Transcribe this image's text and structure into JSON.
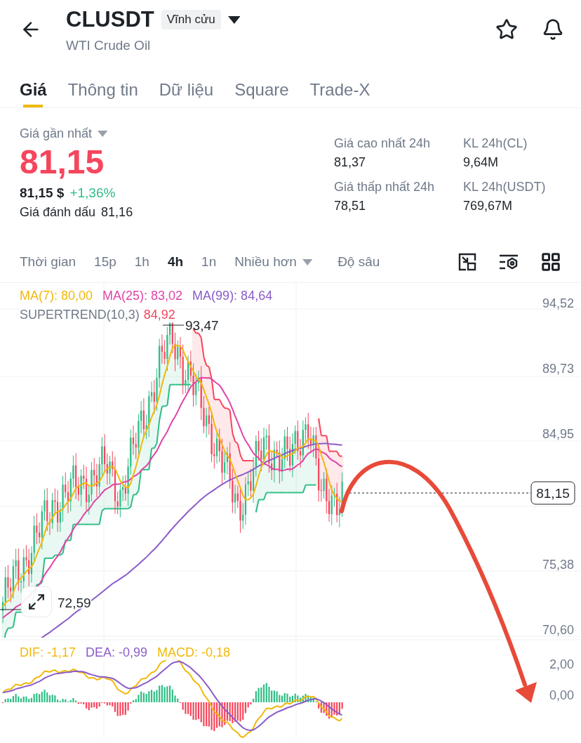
{
  "header": {
    "symbol": "CLUSDT",
    "contract_type": "Vĩnh cửu",
    "name": "WTI Crude Oil"
  },
  "tabs": [
    {
      "label": "Giá",
      "selected": true
    },
    {
      "label": "Thông tin",
      "selected": false
    },
    {
      "label": "Dữ liệu",
      "selected": false
    },
    {
      "label": "Square",
      "selected": false
    },
    {
      "label": "Trade-X",
      "selected": false
    }
  ],
  "price": {
    "label": "Giá gần nhất",
    "last": "81,15",
    "usd": "81,15 $",
    "change": "+1,36%",
    "mark_label": "Giá đánh dấu",
    "mark": "81,16"
  },
  "stats": [
    {
      "label": "Giá cao nhất 24h",
      "value": "81,37"
    },
    {
      "label": "KL 24h(CL)",
      "value": "9,64M"
    },
    {
      "label": "Giá thấp nhất 24h",
      "value": "78,51"
    },
    {
      "label": "KL 24h(USDT)",
      "value": "769,67M"
    }
  ],
  "intervals": [
    {
      "label": "Thời gian",
      "kind": "option",
      "selected": false
    },
    {
      "label": "15p",
      "kind": "option",
      "selected": false
    },
    {
      "label": "1h",
      "kind": "option",
      "selected": false
    },
    {
      "label": "4h",
      "kind": "option",
      "selected": true
    },
    {
      "label": "1n",
      "kind": "option",
      "selected": false
    },
    {
      "label": "Nhiều hơn",
      "kind": "dropdown",
      "selected": false
    },
    {
      "label": "Độ sâu",
      "kind": "option",
      "selected": false
    }
  ],
  "chart": {
    "indicators": [
      {
        "text": "MA(7): 80,00",
        "color": "#f0b90b"
      },
      {
        "text": "MA(25): 83,02",
        "color": "#e044a8"
      },
      {
        "text": "MA(99): 84,64",
        "color": "#8a5cc8"
      }
    ],
    "supertrend": {
      "label": "SUPERTREND(10,3)",
      "value": "84,92"
    },
    "price_axis": [
      "94,52",
      "89,73",
      "84,95",
      "75,38",
      "70,60"
    ],
    "high": "93,47",
    "low": "72,59",
    "last_price": "81,15"
  },
  "macd": {
    "indicators": [
      {
        "text": "DIF: -1,17",
        "color": "#f0b90b"
      },
      {
        "text": "DEA: -0,99",
        "color": "#8a5cc8"
      },
      {
        "text": "MACD: -0,18",
        "color": "#f0b90b"
      }
    ],
    "axis": [
      "2,00",
      "0,00"
    ]
  }
}
